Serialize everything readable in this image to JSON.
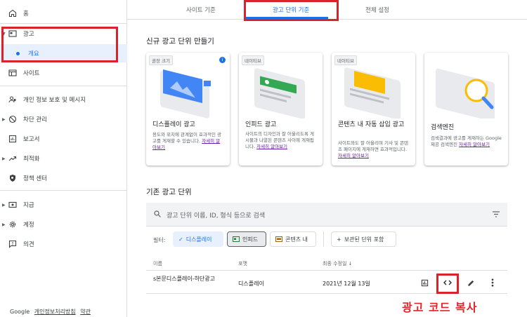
{
  "sidebar": {
    "items": [
      {
        "label": "홈",
        "icon": "home-icon"
      },
      {
        "label": "광고",
        "icon": "ads-icon"
      },
      {
        "label": "개요"
      },
      {
        "label": "사이트",
        "icon": "sites-icon"
      },
      {
        "label": "개인 정보 보호 및 메시지",
        "icon": "privacy-icon"
      },
      {
        "label": "차단 관리",
        "icon": "block-icon"
      },
      {
        "label": "보고서",
        "icon": "reports-icon"
      },
      {
        "label": "최적화",
        "icon": "optimize-icon"
      },
      {
        "label": "정책 센터",
        "icon": "policy-icon"
      },
      {
        "label": "지급",
        "icon": "payments-icon"
      },
      {
        "label": "계정",
        "icon": "account-gear-icon"
      },
      {
        "label": "의견",
        "icon": "feedback-icon"
      }
    ],
    "footer": {
      "brand": "Google",
      "privacy": "개인정보처리방침",
      "terms": "약관"
    }
  },
  "tabs": [
    "사이트 기준",
    "광고 단위 기준",
    "전체 설정"
  ],
  "create_title": "신규 광고 단위 만들기",
  "cards": [
    {
      "badge": "권장 크기",
      "title": "디스플레이 광고",
      "desc": "용도와 위치에 관계없이 효과적인 광고를 게재할 수 있습니다.",
      "link": "자세히 알아보기"
    },
    {
      "badge": "네이티브",
      "title": "인피드 광고",
      "desc": "사이트의 디자인과 잘 어울리도록 게시물과 나열된 콘텐츠 사이에 게재됩니다.",
      "link": "자세히 알아보기"
    },
    {
      "badge": "네이티브",
      "title": "콘텐츠 내 자동 삽입 광고",
      "desc": "사이트와도 잘 어울리며 기사 및 콘텐츠 페이지에 게재하면 효과적입니다.",
      "link": "자세히 알아보기"
    },
    {
      "badge": "",
      "title": "검색엔진",
      "desc": "검색결과에 광고를 게재하는 Google 제공 검색엔진",
      "link": "자세히 알아보기"
    }
  ],
  "existing_title": "기존 광고 단위",
  "search": {
    "placeholder": "광고 단위 이름, ID, 형식 등으로 검색"
  },
  "filters": {
    "label": "필터:",
    "chips": [
      "디스플레이",
      "인피드",
      "콘텐츠 내",
      "보관된 단위 포함"
    ]
  },
  "table": {
    "headers": [
      "이름",
      "포맷",
      "최종 수정일"
    ],
    "rows": [
      {
        "name": "s본문디스플레이-하단광고",
        "format": "디스플레이",
        "modified": "2021년 12월 13일"
      }
    ]
  },
  "annotation": "광고 코드 복사",
  "colors": {
    "accent": "#1a73e8",
    "highlight": "#d9232a"
  }
}
